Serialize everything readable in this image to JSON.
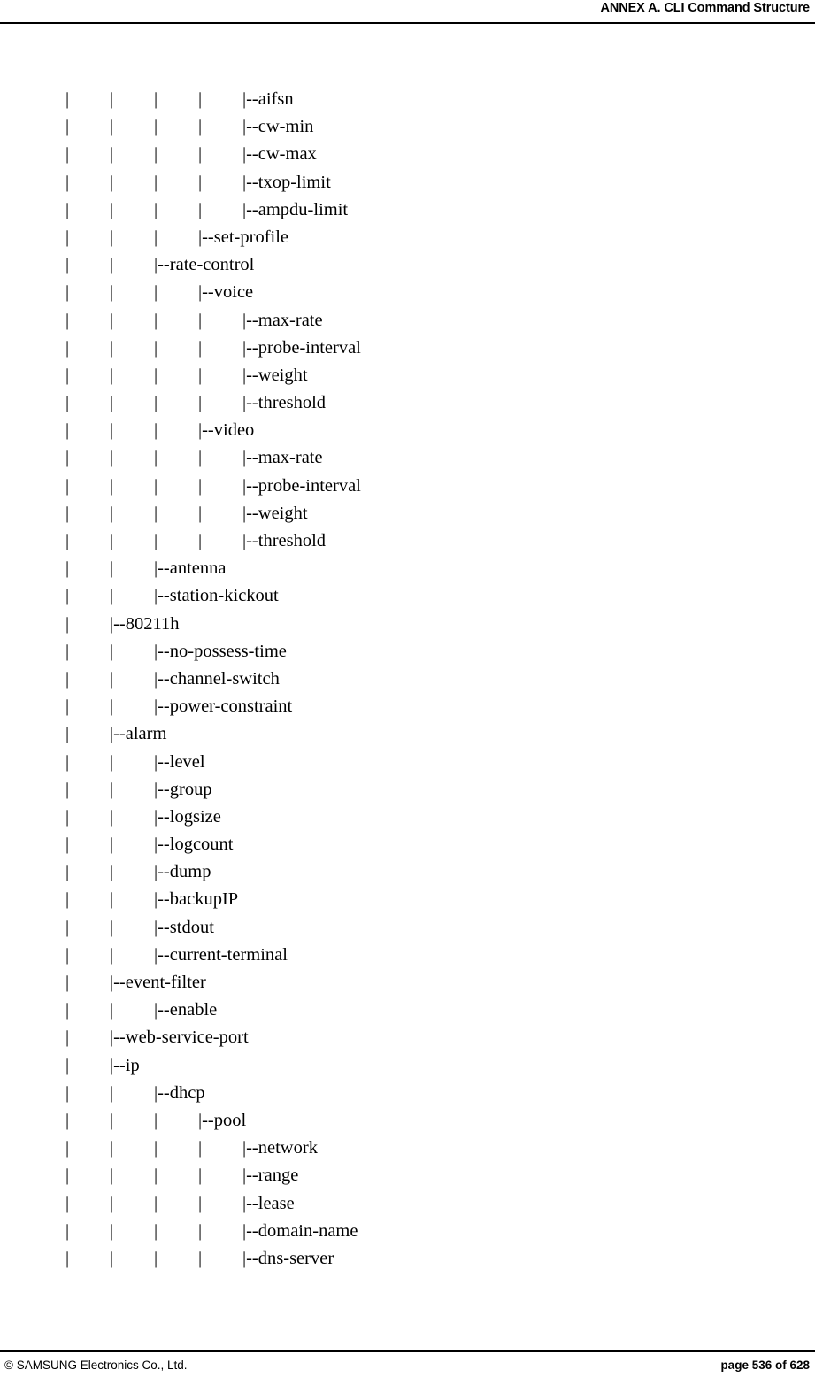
{
  "header": {
    "title": "ANNEX A. CLI Command Structure"
  },
  "footer": {
    "copyright": "© SAMSUNG Electronics Co., Ltd.",
    "page_label": "page 536 of 628"
  },
  "tree": {
    "guide_glyph": "|",
    "branch_glyph": "|--",
    "lines": [
      {
        "depth": 4,
        "label": "aifsn"
      },
      {
        "depth": 4,
        "label": "cw-min"
      },
      {
        "depth": 4,
        "label": "cw-max"
      },
      {
        "depth": 4,
        "label": "txop-limit"
      },
      {
        "depth": 4,
        "label": "ampdu-limit"
      },
      {
        "depth": 3,
        "label": "set-profile"
      },
      {
        "depth": 2,
        "label": "rate-control"
      },
      {
        "depth": 3,
        "label": "voice"
      },
      {
        "depth": 4,
        "label": "max-rate"
      },
      {
        "depth": 4,
        "label": "probe-interval"
      },
      {
        "depth": 4,
        "label": "weight"
      },
      {
        "depth": 4,
        "label": "threshold"
      },
      {
        "depth": 3,
        "label": "video"
      },
      {
        "depth": 4,
        "label": "max-rate"
      },
      {
        "depth": 4,
        "label": "probe-interval"
      },
      {
        "depth": 4,
        "label": "weight"
      },
      {
        "depth": 4,
        "label": "threshold"
      },
      {
        "depth": 2,
        "label": "antenna"
      },
      {
        "depth": 2,
        "label": "station-kickout"
      },
      {
        "depth": 1,
        "label": "80211h"
      },
      {
        "depth": 2,
        "label": "no-possess-time"
      },
      {
        "depth": 2,
        "label": "channel-switch"
      },
      {
        "depth": 2,
        "label": "power-constraint"
      },
      {
        "depth": 1,
        "label": "alarm"
      },
      {
        "depth": 2,
        "label": "level"
      },
      {
        "depth": 2,
        "label": "group"
      },
      {
        "depth": 2,
        "label": "logsize"
      },
      {
        "depth": 2,
        "label": "logcount"
      },
      {
        "depth": 2,
        "label": "dump"
      },
      {
        "depth": 2,
        "label": "backupIP"
      },
      {
        "depth": 2,
        "label": "stdout"
      },
      {
        "depth": 2,
        "label": "current-terminal"
      },
      {
        "depth": 1,
        "label": "event-filter"
      },
      {
        "depth": 2,
        "label": "enable"
      },
      {
        "depth": 1,
        "label": "web-service-port"
      },
      {
        "depth": 1,
        "label": "ip"
      },
      {
        "depth": 2,
        "label": "dhcp"
      },
      {
        "depth": 3,
        "label": "pool"
      },
      {
        "depth": 4,
        "label": "network"
      },
      {
        "depth": 4,
        "label": "range"
      },
      {
        "depth": 4,
        "label": "lease"
      },
      {
        "depth": 4,
        "label": "domain-name"
      },
      {
        "depth": 4,
        "label": "dns-server"
      }
    ]
  }
}
